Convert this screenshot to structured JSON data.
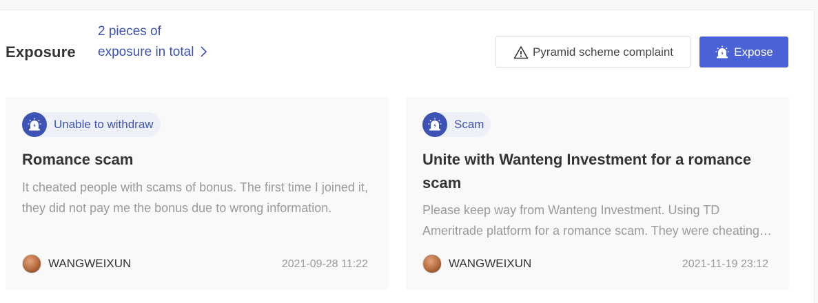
{
  "header": {
    "title": "Exposure",
    "total_link": "2 pieces of exposure in total"
  },
  "actions": {
    "complaint_label": "Pyramid scheme complaint",
    "expose_label": "Expose"
  },
  "colors": {
    "accent": "#4a62d6",
    "tag_text": "#3c52b5"
  },
  "cards": [
    {
      "tag": "Unable to withdraw",
      "title": "Romance scam",
      "body": "It cheated people with scams of bonus. The first time I joined it, they did not pay me the bonus due to wrong information.",
      "author": "WANGWEIXUN",
      "date": "2021-09-28 11:22"
    },
    {
      "tag": "Scam",
      "title": "Unite with Wanteng Investment for a romance scam",
      "body": "Please keep way from Wanteng Investment. Using TD Ameritrade platform for a romance scam. They were cheating people.",
      "author": "WANGWEIXUN",
      "date": "2021-11-19 23:12"
    }
  ],
  "icons": {
    "tag": "alarm-icon",
    "complaint": "warning-icon",
    "expose": "alarm-icon",
    "more": "chevron-right-icon"
  }
}
